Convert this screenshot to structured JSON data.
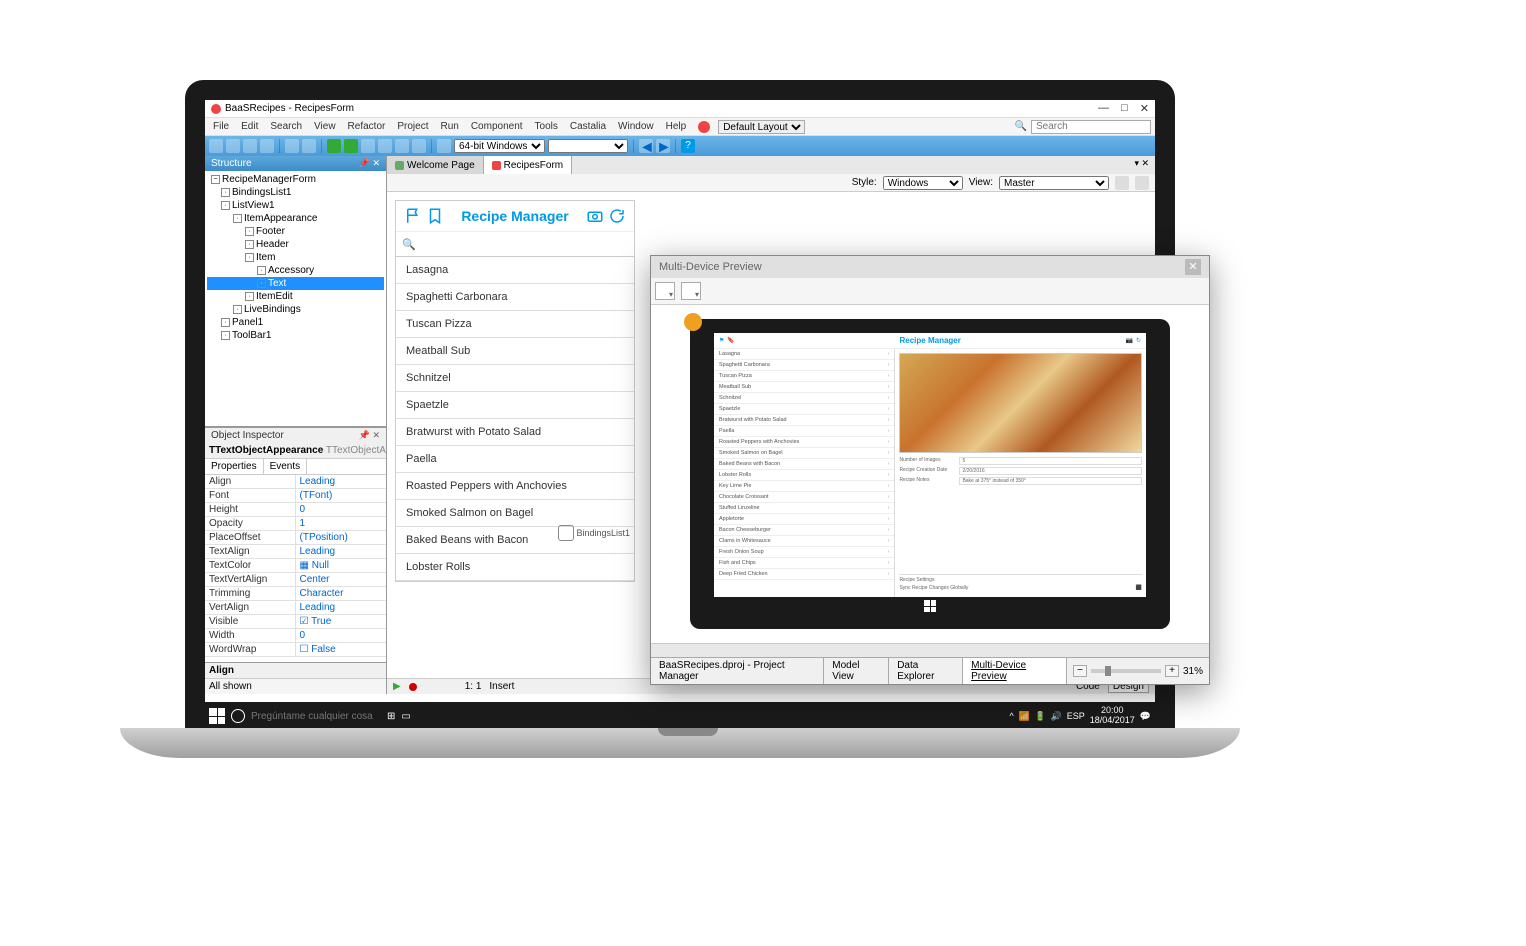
{
  "window": {
    "title": "BaaSRecipes - RecipesForm"
  },
  "menubar": [
    "File",
    "Edit",
    "Search",
    "View",
    "Refactor",
    "Project",
    "Run",
    "Component",
    "Tools",
    "Castalia",
    "Window",
    "Help"
  ],
  "layout_select": "Default Layout",
  "search_placeholder": "Search",
  "platform_select": "64-bit Windows",
  "structure": {
    "title": "Structure",
    "root": "RecipeManagerForm",
    "items": [
      {
        "label": "BindingsList1",
        "indent": 1
      },
      {
        "label": "ListView1",
        "indent": 1
      },
      {
        "label": "ItemAppearance",
        "indent": 2
      },
      {
        "label": "Footer",
        "indent": 3
      },
      {
        "label": "Header",
        "indent": 3
      },
      {
        "label": "Item",
        "indent": 3
      },
      {
        "label": "Accessory",
        "indent": 4
      },
      {
        "label": "Text",
        "indent": 4,
        "selected": true
      },
      {
        "label": "ItemEdit",
        "indent": 3
      },
      {
        "label": "LiveBindings",
        "indent": 2
      },
      {
        "label": "Panel1",
        "indent": 1
      },
      {
        "label": "ToolBar1",
        "indent": 1
      }
    ]
  },
  "object_inspector": {
    "title": "Object Inspector",
    "component": "TTextObjectAppearance",
    "class_hint": "TTextObjectAppe",
    "tabs": [
      "Properties",
      "Events"
    ],
    "props": [
      {
        "name": "Align",
        "val": "Leading"
      },
      {
        "name": "Font",
        "val": "(TFont)"
      },
      {
        "name": "Height",
        "val": "0"
      },
      {
        "name": "Opacity",
        "val": "1"
      },
      {
        "name": "PlaceOffset",
        "val": "(TPosition)"
      },
      {
        "name": "TextAlign",
        "val": "Leading"
      },
      {
        "name": "TextColor",
        "val": "Null",
        "checker": true
      },
      {
        "name": "TextVertAlign",
        "val": "Center"
      },
      {
        "name": "Trimming",
        "val": "Character"
      },
      {
        "name": "VertAlign",
        "val": "Leading"
      },
      {
        "name": "Visible",
        "val": "True",
        "check": true
      },
      {
        "name": "Width",
        "val": "0"
      },
      {
        "name": "WordWrap",
        "val": "False",
        "check": false
      }
    ],
    "footer": "Align",
    "shown": "All shown"
  },
  "doc_tabs": [
    {
      "label": "Welcome Page"
    },
    {
      "label": "RecipesForm",
      "active": true
    }
  ],
  "style_bar": {
    "style_label": "Style:",
    "style_value": "Windows",
    "view_label": "View:",
    "view_value": "Master"
  },
  "recipe_app": {
    "title": "Recipe Manager",
    "search_icon": "search",
    "items": [
      "Lasagna",
      "Spaghetti Carbonara",
      "Tuscan Pizza",
      "Meatball Sub",
      "Schnitzel",
      "Spaetzle",
      "Bratwurst with Potato Salad",
      "Paella",
      "Roasted Peppers with Anchovies",
      "Smoked Salmon on Bagel",
      "Baked Beans with Bacon",
      "Lobster Rolls"
    ],
    "bindings_label": "BindingsList1"
  },
  "ide_status": {
    "cursor": "1: 1",
    "mode": "Insert",
    "code": "Code",
    "design": "Design"
  },
  "mdp": {
    "title": "Multi-Device Preview",
    "app_title": "Recipe Manager",
    "list": [
      "Lasagna",
      "Spaghetti Carbonara",
      "Tuscan Pizza",
      "Meatball Sub",
      "Schnitzel",
      "Spaetzle",
      "Bratwurst with Potato Salad",
      "Paella",
      "Roasted Peppers with Anchovies",
      "Smoked Salmon on Bagel",
      "Baked Beans with Bacon",
      "Lobster Rolls",
      "Key Lime Pie",
      "Chocolate Croissant",
      "Stuffed Linzeline",
      "Appletorte",
      "Bacon Cheeseburger",
      "Clams in Whitesauce",
      "Fresh Onion Soup",
      "Fish and Chips",
      "Deep Fried Chicken"
    ],
    "detail_fields": [
      {
        "l": "Number of Images",
        "v": "5"
      },
      {
        "l": "Recipe Creation Date",
        "v": "2/20/2016"
      },
      {
        "l": "Recipe Notes",
        "v": "Bake at 375° instead of 350°"
      }
    ],
    "settings": [
      "Recipe Settings",
      "Sync Recipe Changes Globally"
    ],
    "bottom_tabs": [
      "BaaSRecipes.dproj - Project Manager",
      "Model View",
      "Data Explorer",
      "Multi-Device Preview"
    ],
    "zoom": "31%"
  },
  "taskbar": {
    "search": "Pregúntame cualquier cosa",
    "lang": "ESP",
    "time": "20:00",
    "date": "18/04/2017"
  }
}
